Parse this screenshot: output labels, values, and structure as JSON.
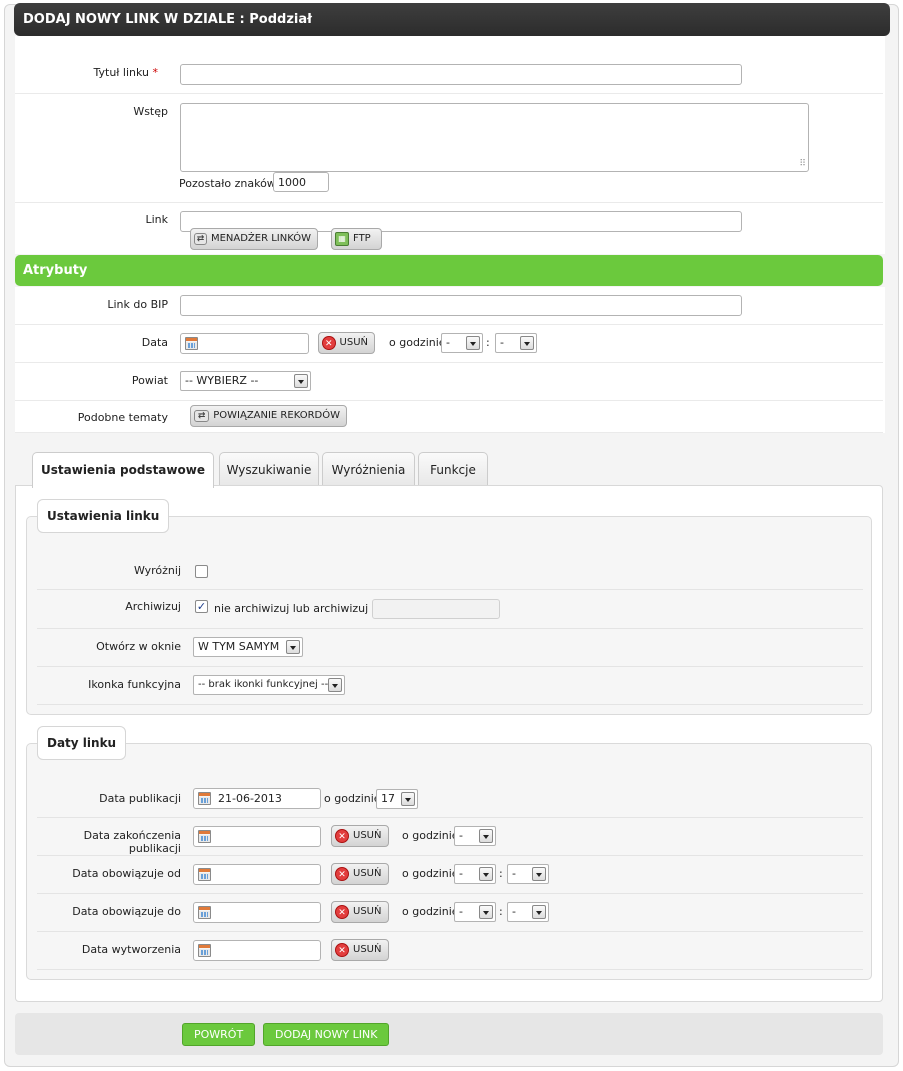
{
  "header": {
    "title": "DODAJ NOWY LINK W DZIALE : Poddział"
  },
  "form": {
    "title_label": "Tytuł linku",
    "required_mark": "*",
    "title_value": "",
    "intro_label": "Wstęp",
    "intro_value": "",
    "remaining_label": "Pozostało znaków:",
    "remaining_value": "1000",
    "link_label": "Link",
    "link_value": "",
    "link_manager_button": "MENADŻER LINKÓW",
    "ftp_button": "FTP"
  },
  "attributes": {
    "section_title": "Atrybuty",
    "bip_label": "Link do BIP",
    "bip_value": "",
    "date_label": "Data",
    "date_value": "",
    "delete_button": "USUŃ",
    "at_hour_label": "o godzinie",
    "hour_value": "-",
    "minute_value": "-",
    "colon": ":",
    "county_label": "Powiat",
    "county_value": "-- WYBIERZ --",
    "similar_label": "Podobne tematy",
    "relate_button": "POWIĄZANIE REKORDÓW"
  },
  "tabs": [
    {
      "label": "Ustawienia podstawowe",
      "active": true
    },
    {
      "label": "Wyszukiwanie",
      "active": false
    },
    {
      "label": "Wyróżnienia",
      "active": false
    },
    {
      "label": "Funkcje",
      "active": false
    }
  ],
  "link_settings": {
    "legend": "Ustawienia linku",
    "highlight_label": "Wyróżnij",
    "highlight_checked": false,
    "archive_label": "Archiwizuj",
    "archive_checked": true,
    "archive_text": "nie archiwizuj lub archiwizuj dnia",
    "archive_date": "",
    "open_in_label": "Otwórz w oknie",
    "open_in_value": "W TYM SAMYM",
    "icon_label": "Ikonka funkcyjna",
    "icon_value": "-- brak ikonki funkcyjnej --"
  },
  "link_dates": {
    "legend": "Daty linku",
    "pub_label": "Data publikacji",
    "pub_value": "21-06-2013",
    "pub_hour_label": "o godzinie",
    "pub_hour_value": "17",
    "end_label": "Data zakończenia publikacji",
    "valid_from_label": "Data obowiązuje od",
    "valid_to_label": "Data obowiązuje do",
    "created_label": "Data wytworzenia",
    "empty_date": "",
    "delete_button": "USUŃ",
    "at_hour_label": "o godzinie",
    "dash": "-",
    "colon": ":"
  },
  "footer": {
    "back_button": "POWRÓT",
    "add_button": "DODAJ NOWY LINK"
  },
  "colors": {
    "green": "#6bc93d",
    "header": "#333333"
  }
}
